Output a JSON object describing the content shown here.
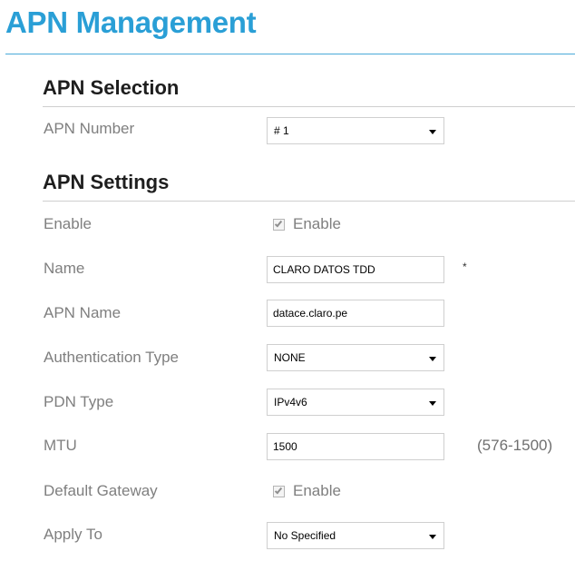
{
  "page": {
    "title": "APN Management"
  },
  "apn_selection": {
    "heading": "APN Selection",
    "apn_number": {
      "label": "APN Number",
      "value": "# 1"
    }
  },
  "apn_settings": {
    "heading": "APN Settings",
    "enable": {
      "label": "Enable",
      "checkbox_label": "Enable",
      "checked": true
    },
    "name": {
      "label": "Name",
      "value": "CLARO DATOS TDD",
      "required_marker": "*"
    },
    "apn_name": {
      "label": "APN Name",
      "value": "datace.claro.pe"
    },
    "authentication_type": {
      "label": "Authentication Type",
      "value": "NONE"
    },
    "pdn_type": {
      "label": "PDN Type",
      "value": "IPv4v6"
    },
    "mtu": {
      "label": "MTU",
      "value": "1500",
      "range_hint": "(576-1500)"
    },
    "default_gateway": {
      "label": "Default Gateway",
      "checkbox_label": "Enable",
      "checked": true
    },
    "apply_to": {
      "label": "Apply To",
      "value": "No Specified"
    }
  },
  "colors": {
    "title": "#2a9fd6",
    "label": "#7f7f7f",
    "heading": "#1e1e1e",
    "border": "#cfcfcf"
  }
}
